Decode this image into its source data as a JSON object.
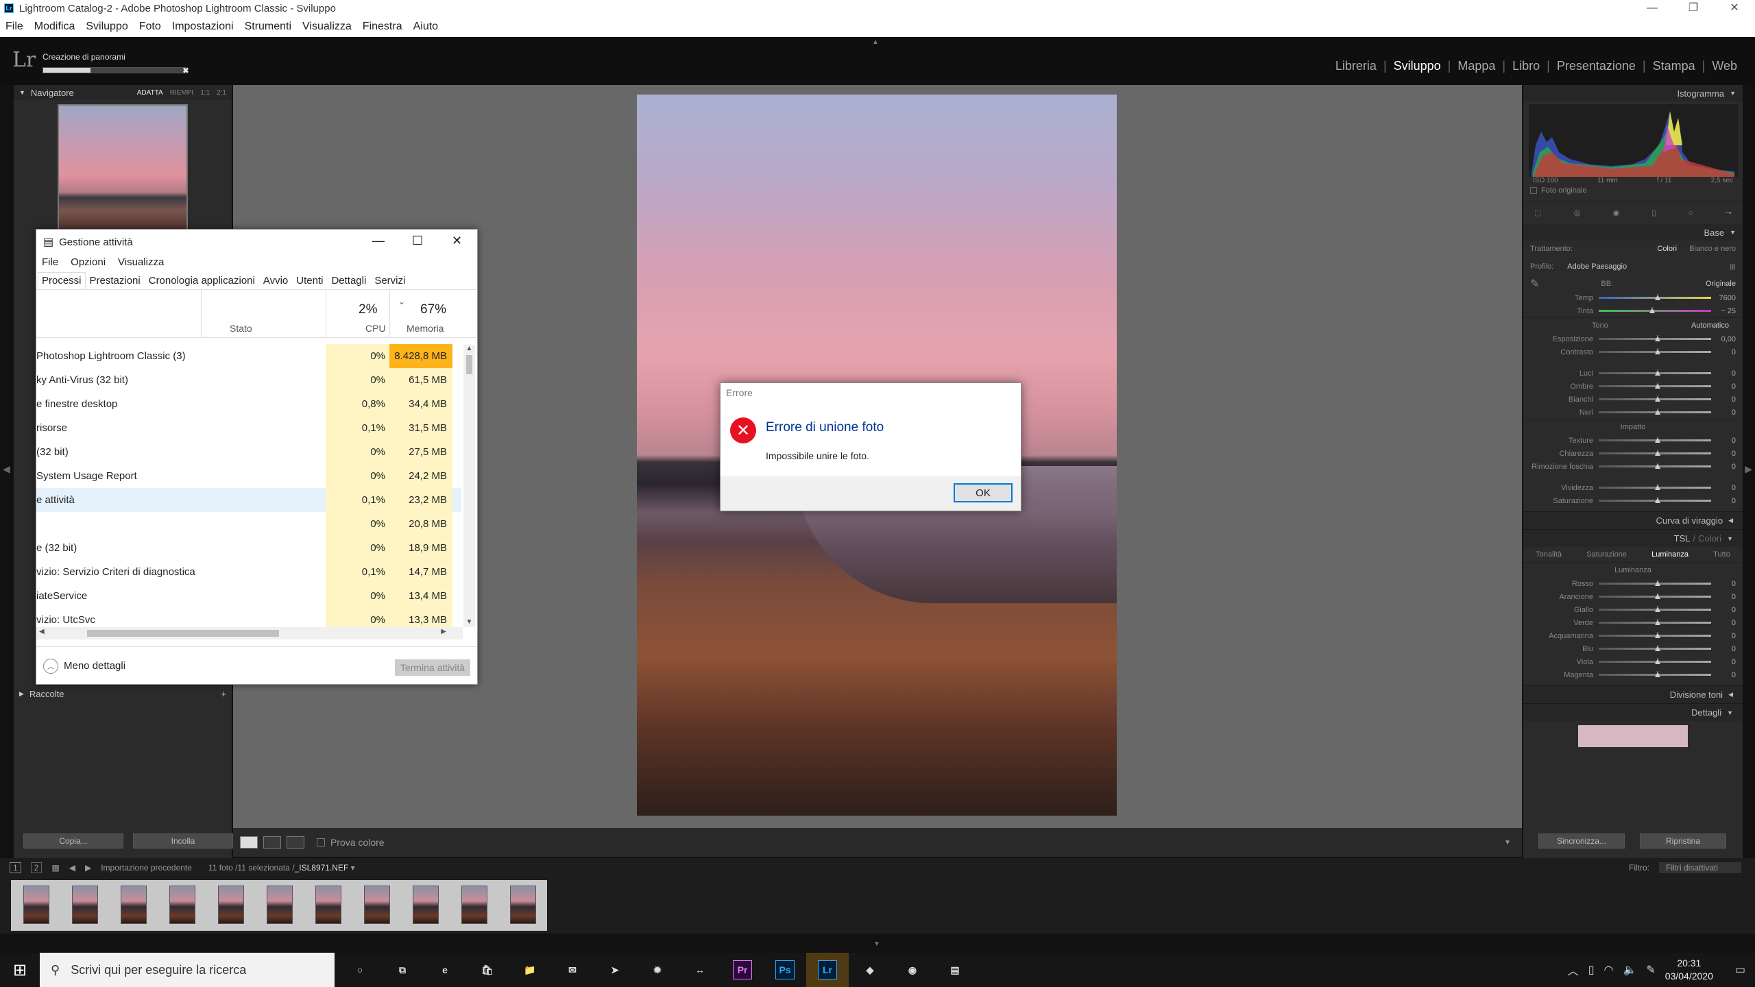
{
  "window": {
    "title": "Lightroom Catalog-2 - Adobe Photoshop Lightroom Classic - Sviluppo",
    "app_icon": "Lr",
    "controls": [
      "—",
      "❐",
      "✕"
    ]
  },
  "menu": [
    "File",
    "Modifica",
    "Sviluppo",
    "Foto",
    "Impostazioni",
    "Strumenti",
    "Visualizza",
    "Finestra",
    "Aiuto"
  ],
  "lr": {
    "logo": "Lr",
    "task": {
      "label": "Creazione di panorami",
      "progress": 0.33
    },
    "modules": [
      "Libreria",
      "Sviluppo",
      "Mappa",
      "Libro",
      "Presentazione",
      "Stampa",
      "Web"
    ],
    "active_module": "Sviluppo"
  },
  "left": {
    "navigator": "Navigatore",
    "nav_opts": [
      "ADATTA",
      "RIEMPI",
      "1:1",
      "2:1"
    ],
    "collections": "Raccolte",
    "copy": "Copia...",
    "paste": "Incolla"
  },
  "toolbar": {
    "proof": "Prova colore"
  },
  "right": {
    "histogram": "Istogramma",
    "histo_info": [
      "ISO 100",
      "11 mm",
      "f / 11",
      "2,5 sec"
    ],
    "original_photo": "Foto originale",
    "base": "Base",
    "treatment_label": "Trattamento:",
    "treatment_color": "Colori",
    "treatment_bw": "Bianco e nero",
    "profile_label": "Profilo:",
    "profile_value": "Adobe Paesaggio",
    "wb_label": "BB:",
    "wb_value": "Originale",
    "temp": {
      "label": "Temp",
      "value": "7600"
    },
    "tint": {
      "label": "Tinta",
      "value": "− 25"
    },
    "tone": "Tono",
    "auto": "Automatico",
    "tone_rows": [
      {
        "label": "Esposizione",
        "value": "0,00"
      },
      {
        "label": "Contrasto",
        "value": "0"
      },
      {
        "label": "Luci",
        "value": "0"
      },
      {
        "label": "Ombre",
        "value": "0"
      },
      {
        "label": "Bianchi",
        "value": "0"
      },
      {
        "label": "Neri",
        "value": "0"
      }
    ],
    "impact": "Impatto",
    "impact_rows": [
      {
        "label": "Texture",
        "value": "0"
      },
      {
        "label": "Chiarezza",
        "value": "0"
      },
      {
        "label": "Rimozione foschia",
        "value": "0"
      },
      {
        "label": "Vividezza",
        "value": "0"
      },
      {
        "label": "Saturazione",
        "value": "0"
      }
    ],
    "curve": "Curva di viraggio",
    "tsl": "TSL",
    "tsl_sep": "/",
    "tsl_colors": "Colori",
    "tsl_tabs": [
      "Tonalità",
      "Saturazione",
      "Luminanza",
      "Tutto"
    ],
    "luminance": "Luminanza",
    "lum_rows": [
      {
        "label": "Rosso",
        "value": "0"
      },
      {
        "label": "Arancione",
        "value": "0"
      },
      {
        "label": "Giallo",
        "value": "0"
      },
      {
        "label": "Verde",
        "value": "0"
      },
      {
        "label": "Acquamarina",
        "value": "0"
      },
      {
        "label": "Blu",
        "value": "0"
      },
      {
        "label": "Viola",
        "value": "0"
      },
      {
        "label": "Magenta",
        "value": "0"
      }
    ],
    "split": "Divisione toni",
    "details": "Dettagli",
    "sync": "Sincronizza...",
    "reset": "Ripristina"
  },
  "filmbar": {
    "screens": [
      "1",
      "2"
    ],
    "source": "Importazione precedente",
    "count": "11 foto /11 selezionata /",
    "file": "_ISL8971.NEF",
    "filter_label": "Filtro:",
    "filter_value": "Filtri disattivati"
  },
  "taskmanager": {
    "title": "Gestione attività",
    "controls": [
      "—",
      "☐",
      "✕"
    ],
    "menu": [
      "File",
      "Opzioni",
      "Visualizza"
    ],
    "tabs": [
      "Processi",
      "Prestazioni",
      "Cronologia applicazioni",
      "Avvio",
      "Utenti",
      "Dettagli",
      "Servizi"
    ],
    "col_status": "Stato",
    "cpu_pct": "2%",
    "cpu_label": "CPU",
    "mem_pct": "67%",
    "mem_label": "Memoria",
    "rows": [
      {
        "name": "Photoshop Lightroom Classic (3)",
        "cpu": "0%",
        "mem": "8.428,8 MB"
      },
      {
        "name": "ky Anti-Virus (32 bit)",
        "cpu": "0%",
        "mem": "61,5 MB"
      },
      {
        "name": "e finestre desktop",
        "cpu": "0,8%",
        "mem": "34,4 MB"
      },
      {
        "name": "risorse",
        "cpu": "0,1%",
        "mem": "31,5 MB"
      },
      {
        "name": "(32 bit)",
        "cpu": "0%",
        "mem": "27,5 MB"
      },
      {
        "name": "System Usage Report",
        "cpu": "0%",
        "mem": "24,2 MB"
      },
      {
        "name": "e attività",
        "cpu": "0,1%",
        "mem": "23,2 MB"
      },
      {
        "name": "",
        "cpu": "0%",
        "mem": "20,8 MB"
      },
      {
        "name": "e (32 bit)",
        "cpu": "0%",
        "mem": "18,9 MB"
      },
      {
        "name": "vizio: Servizio Criteri di diagnostica",
        "cpu": "0,1%",
        "mem": "14,7 MB"
      },
      {
        "name": "iateService",
        "cpu": "0%",
        "mem": "13,4 MB"
      },
      {
        "name": "vizio: UtcSvc",
        "cpu": "0%",
        "mem": "13,3 MB"
      }
    ],
    "less_details": "Meno dettagli",
    "end_task": "Termina attività"
  },
  "error": {
    "title": "Errore",
    "heading": "Errore di unione foto",
    "message": "Impossibile unire le foto.",
    "ok": "OK"
  },
  "taskbar": {
    "search_placeholder": "Scrivi qui per eseguire la ricerca",
    "time": "20:31",
    "date": "03/04/2020",
    "apps": [
      {
        "name": "cortana-icon",
        "glyph": "○"
      },
      {
        "name": "task-view-icon",
        "glyph": "⧉"
      },
      {
        "name": "edge-icon",
        "glyph": "e"
      },
      {
        "name": "store-icon",
        "glyph": "🛍"
      },
      {
        "name": "explorer-icon",
        "glyph": "📁"
      },
      {
        "name": "mail-icon",
        "glyph": "✉"
      },
      {
        "name": "send-icon",
        "glyph": "➤"
      },
      {
        "name": "avast-icon",
        "glyph": "✹"
      },
      {
        "name": "teamviewer-icon",
        "glyph": "↔"
      },
      {
        "name": "premiere-icon",
        "glyph": "Pr"
      },
      {
        "name": "photoshop-icon",
        "glyph": "Ps"
      },
      {
        "name": "lightroom-icon",
        "glyph": "Lr"
      },
      {
        "name": "app-icon",
        "glyph": "◆"
      },
      {
        "name": "chrome-icon",
        "glyph": "◉"
      },
      {
        "name": "task-manager-icon",
        "glyph": "▤"
      }
    ]
  },
  "colors": {
    "lr_bg": "#2b2b2b",
    "canvas": "#686868",
    "mem_hot": "#ffb31a",
    "mem_cell": "#fff4c4",
    "error_red": "#e81123",
    "link_blue": "#003399"
  }
}
